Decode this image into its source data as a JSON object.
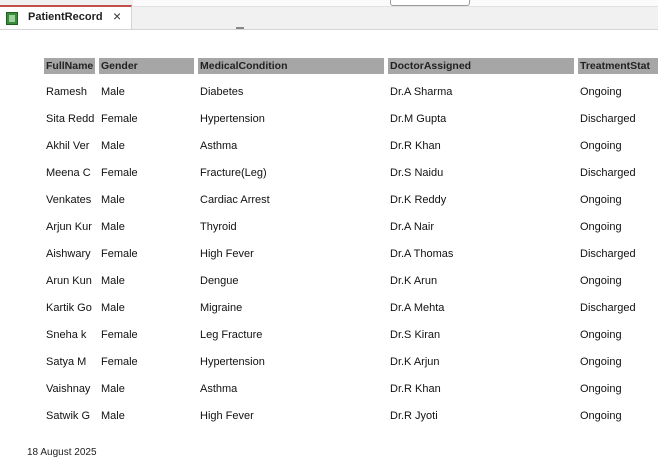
{
  "tab": {
    "title": "PatientRecord",
    "close_glyph": "×",
    "icon": "table-icon"
  },
  "columns": [
    "FullName",
    "Gender",
    "MedicalCondition",
    "DoctorAssigned",
    "TreatmentStat"
  ],
  "rows": [
    [
      "Ramesh",
      "Male",
      "Diabetes",
      "Dr.A Sharma",
      "Ongoing"
    ],
    [
      "Sita Redd",
      "Female",
      "Hypertension",
      "Dr.M Gupta",
      "Discharged"
    ],
    [
      "Akhil Ver",
      "Male",
      "Asthma",
      "Dr.R Khan",
      "Ongoing"
    ],
    [
      "Meena C",
      "Female",
      "Fracture(Leg)",
      "Dr.S Naidu",
      "Discharged"
    ],
    [
      "Venkates",
      "Male",
      "Cardiac Arrest",
      "Dr.K Reddy",
      "Ongoing"
    ],
    [
      "Arjun Kur",
      "Male",
      "Thyroid",
      "Dr.A Nair",
      "Ongoing"
    ],
    [
      "Aishwary",
      "Female",
      "High Fever",
      "Dr.A Thomas",
      "Discharged"
    ],
    [
      "Arun Kun",
      "Male",
      "Dengue",
      "Dr.K Arun",
      "Ongoing"
    ],
    [
      "Kartik Go",
      "Male",
      "Migraine",
      "Dr.A Mehta",
      "Discharged"
    ],
    [
      "Sneha k",
      "Female",
      "Leg Fracture",
      "Dr.S Kiran",
      "Ongoing"
    ],
    [
      "Satya M",
      "Female",
      "Hypertension",
      "Dr.K Arjun",
      "Ongoing"
    ],
    [
      "Vaishnay",
      "Male",
      "Asthma",
      "Dr.R Khan",
      "Ongoing"
    ],
    [
      "Satwik G",
      "Male",
      "High Fever",
      "Dr.R Jyoti",
      "Ongoing"
    ]
  ],
  "footer": {
    "date": "18 August 2025"
  },
  "colors": {
    "tab_accent": "#c0504d",
    "header_bg": "#a6a6a6"
  }
}
